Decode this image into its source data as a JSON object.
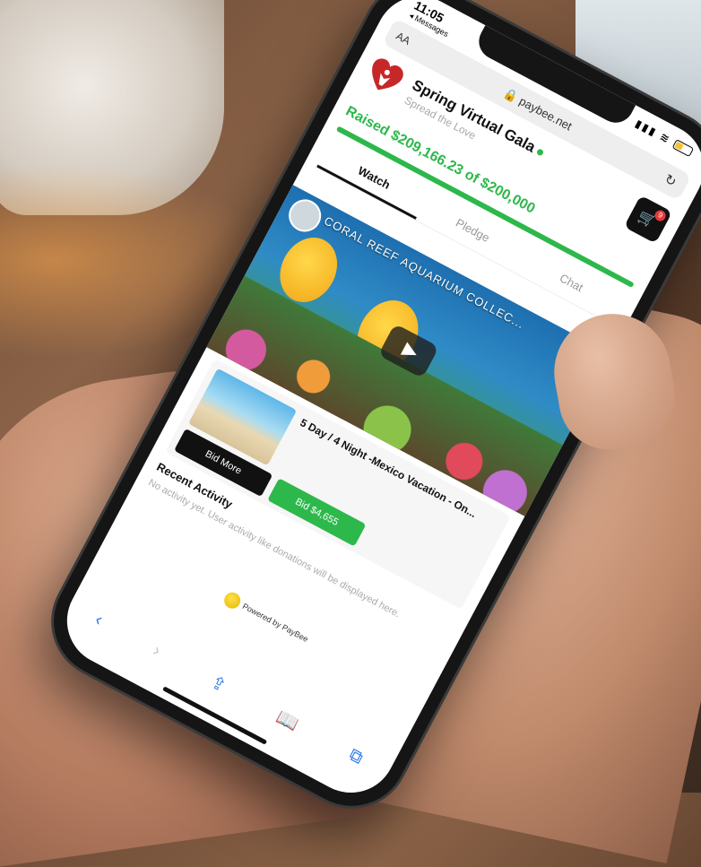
{
  "status": {
    "time": "11:05",
    "back_label": "◂ Messages"
  },
  "browser": {
    "aa": "AA",
    "url": "paybee.net",
    "reload_icon": "reload-icon"
  },
  "event": {
    "title": "Spring Virtual Gala",
    "subtitle": "Spread the Love",
    "raised_text": "Raised $209,166.23 of $200,000",
    "raised": 209166.23,
    "goal": 200000,
    "cart_count": "9"
  },
  "tabs": [
    {
      "label": "Watch",
      "active": true
    },
    {
      "label": "Pledge",
      "active": false
    },
    {
      "label": "Chat",
      "active": false
    }
  ],
  "video": {
    "title": "CORAL REEF AQUARIUM COLLEC..."
  },
  "item": {
    "title": "5 Day / 4 Night -Mexico Vacation - On...",
    "bid_more": "Bid More",
    "bid_amount": "Bid $4,655"
  },
  "activity": {
    "heading": "Recent Activity",
    "empty": "No activity yet. User activity like donations will be displayed here."
  },
  "footer": {
    "powered_by": "Powered by PayBee"
  },
  "colors": {
    "accent": "#2db84b",
    "dark": "#111111",
    "link": "#2c7be5"
  }
}
